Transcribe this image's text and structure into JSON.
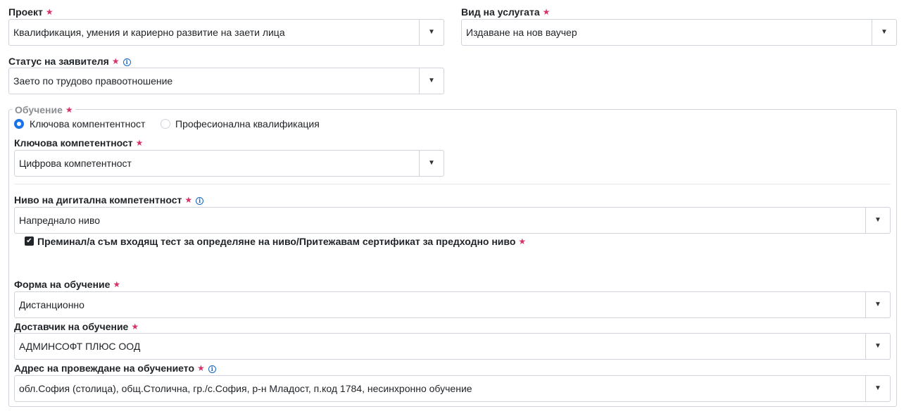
{
  "project": {
    "label": "Проект",
    "value": "Квалификация, умения и кариерно развитие на заети лица"
  },
  "service_type": {
    "label": "Вид на услугата",
    "value": "Издаване на нов ваучер"
  },
  "applicant_status": {
    "label": "Статус на заявителя",
    "value": "Заето по трудово правоотношение"
  },
  "training": {
    "legend": "Обучение",
    "radio_key": "Ключова компентентност",
    "radio_prof": "Професионална квалификация",
    "key_competence": {
      "label": "Ключова компетентност",
      "value": "Цифрова компетентност"
    },
    "digital_level": {
      "label": "Ниво на дигитална компетентност",
      "value": "Напреднало ниво"
    },
    "test_checkbox_label": "Преминал/а съм входящ тест за определяне на ниво/Притежавам сертификат за предходно ниво",
    "form": {
      "label": "Форма на обучение",
      "value": "Дистанционно"
    },
    "provider": {
      "label": "Доставчик на обучение",
      "value": "АДМИНСОФТ ПЛЮС ООД"
    },
    "address": {
      "label": "Адрес на провеждане на обучението",
      "value": "обл.София (столица), общ.Столична, гр./с.София, р-н Младост, п.код 1784, несинхронно обучение"
    }
  },
  "symbols": {
    "required": "★",
    "info": "i",
    "caret": "▼",
    "check": "✔"
  },
  "colors": {
    "required": "#d6336c",
    "info": "#1565c0",
    "radio_selected": "#1a73e8"
  }
}
